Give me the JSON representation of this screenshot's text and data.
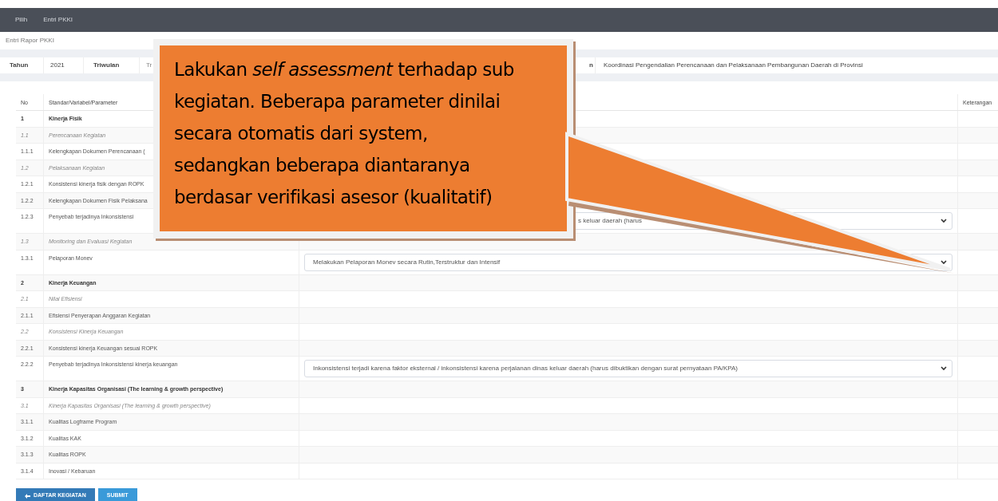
{
  "nav": [
    {
      "label": "Pilih"
    },
    {
      "label": "Entri PKKI"
    }
  ],
  "breadcrumb": "Entri Rapor PKKI",
  "info": [
    {
      "label": "Tahun",
      "value": "2021"
    },
    {
      "label": "Triwulan",
      "value": "Tr"
    },
    {
      "label": "n",
      "value": "Koordinasi Pengendalian Perencanaan dan Pelaksanaan Pembangunan Daerah di Provinsi"
    }
  ],
  "table": {
    "columns": [
      "No",
      "Standar/Variabel/Parameter",
      "Keterangan"
    ],
    "rows": [
      {
        "no": "1",
        "label": "Kinerja Fisik",
        "kind": "heading"
      },
      {
        "no": "1.1",
        "label": "Perencanaan Kegiatan",
        "kind": "group"
      },
      {
        "no": "1.1.1",
        "label": "Kelengkapan Dokumen Perencanaan (",
        "kind": "item"
      },
      {
        "no": "1.2",
        "label": "Pelaksanaan Kegiatan",
        "kind": "group"
      },
      {
        "no": "1.2.1",
        "label": "Konsistensi kinerja fisik dengan ROPK",
        "kind": "item"
      },
      {
        "no": "1.2.2",
        "label": "Kelengkapan Dokumen Fisik Pelaksana",
        "kind": "item"
      },
      {
        "no": "1.2.3",
        "label": "Penyebab terjadinya Inkonsistensi",
        "kind": "item",
        "select": "s keluar daerah (harus",
        "select_partly_hidden": true
      },
      {
        "no": "1.3",
        "label": "Monitoring dan Evaluasi Kegiatan",
        "kind": "group"
      },
      {
        "no": "1.3.1",
        "label": "Pelaporan Monev",
        "kind": "item",
        "select": "Melakukan Pelaporan Monev secara Rutin,Terstruktur dan Intensif",
        "select_partly_hidden": false
      },
      {
        "no": "2",
        "label": "Kinerja Keuangan",
        "kind": "heading"
      },
      {
        "no": "2.1",
        "label": "Nilai Efisiensi",
        "kind": "group"
      },
      {
        "no": "2.1.1",
        "label": "Efisiensi Penyerapan Anggaran Kegiatan",
        "kind": "item"
      },
      {
        "no": "2.2",
        "label": "Konsistensi Kinerja Keuangan",
        "kind": "group"
      },
      {
        "no": "2.2.1",
        "label": "Konsistensi kinerja Keuangan sesuai ROPK",
        "kind": "item"
      },
      {
        "no": "2.2.2",
        "label": "Penyebab terjadinya Inkonsistensi kinerja keuangan",
        "kind": "item",
        "select": "Inkonsistensi terjadi karena faktor eksternal / inkonsistensi karena perjalanan dinas keluar daerah (harus dibuktikan dengan surat pernyataan PA/KPA)",
        "select_partly_hidden": false
      },
      {
        "no": "3",
        "label": "Kinerja Kapasitas Organisasi (The learning & growth perspective)",
        "kind": "heading"
      },
      {
        "no": "3.1",
        "label": "Kinerja Kapasitas Organisasi (The learning & growth perspective)",
        "kind": "group"
      },
      {
        "no": "3.1.1",
        "label": "Kualitas Logframe Program",
        "kind": "item"
      },
      {
        "no": "3.1.2",
        "label": "Kualitas KAK",
        "kind": "item"
      },
      {
        "no": "3.1.3",
        "label": "Kualitas ROPK",
        "kind": "item"
      },
      {
        "no": "3.1.4",
        "label": "Inovasi / Kebaruan",
        "kind": "item"
      }
    ]
  },
  "buttons": [
    {
      "label": "DAFTAR KEGIATAN",
      "kind": "back"
    },
    {
      "label": "SUBMIT",
      "kind": "submit"
    }
  ],
  "callout": [
    "Lakukan *self assessment* terhadap sub",
    "kegiatan. Beberapa parameter dinilai",
    "secara otomatis dari system,",
    "sedangkan beberapa diantaranya",
    "berdasar verifikasi asesor (kualitatif)"
  ]
}
